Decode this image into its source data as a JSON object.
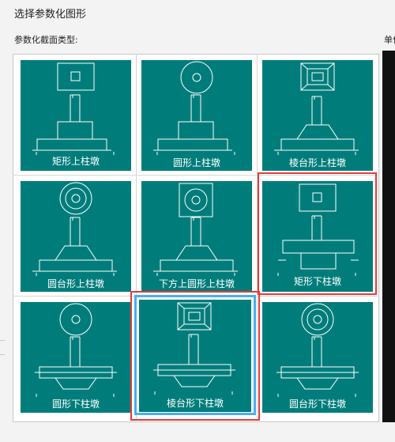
{
  "window": {
    "title": "选择参数化图形"
  },
  "section_label": "参数化截面类型:",
  "right_label": "单位",
  "shapes": [
    {
      "label": "矩形上柱墩",
      "top": "square",
      "base": "step-up"
    },
    {
      "label": "圆形上柱墩",
      "top": "circle",
      "base": "step-up"
    },
    {
      "label": "棱台形上柱墩",
      "top": "frustum",
      "base": "trap-up"
    },
    {
      "label": "圆台形上柱墩",
      "top": "cone",
      "base": "trap-up"
    },
    {
      "label": "下方上圆形上柱墩",
      "top": "square-circle",
      "base": "trap-up"
    },
    {
      "label": "矩形下柱墩",
      "top": "square",
      "base": "step-down"
    },
    {
      "label": "圆形下柱墩",
      "top": "circle",
      "base": "trap-down"
    },
    {
      "label": "棱台形下柱墩",
      "top": "frustum",
      "base": "trap-down"
    },
    {
      "label": "圆台形下柱墩",
      "top": "cone",
      "base": "trap-down"
    }
  ],
  "selected_index": 7,
  "highlighted_indices": [
    5,
    7
  ],
  "colors": {
    "tile": "#007d7b",
    "selection": "#48aef0",
    "highlight": "#e43b3b",
    "line": "#ffffff"
  }
}
